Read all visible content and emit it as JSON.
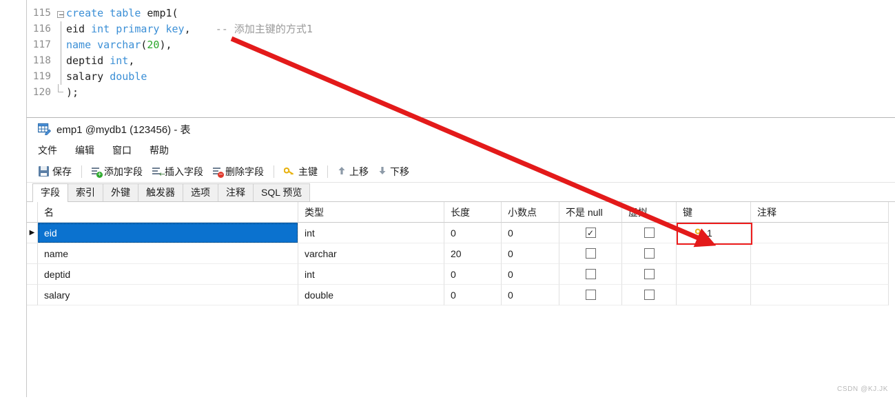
{
  "editor": {
    "lines": [
      {
        "num": "115",
        "tokens": [
          {
            "t": "create",
            "c": "kw"
          },
          {
            "t": " ",
            "c": "plain"
          },
          {
            "t": "table",
            "c": "kw"
          },
          {
            "t": " emp1(",
            "c": "plain"
          }
        ]
      },
      {
        "num": "116",
        "tokens": [
          {
            "t": "eid ",
            "c": "plain"
          },
          {
            "t": "int",
            "c": "kw"
          },
          {
            "t": " ",
            "c": "plain"
          },
          {
            "t": "primary",
            "c": "kw"
          },
          {
            "t": " ",
            "c": "plain"
          },
          {
            "t": "key",
            "c": "kw"
          },
          {
            "t": ",",
            "c": "plain"
          },
          {
            "t": "    -- 添加主键的方式1",
            "c": "cmt"
          }
        ]
      },
      {
        "num": "117",
        "tokens": [
          {
            "t": "name",
            "c": "kw"
          },
          {
            "t": " ",
            "c": "plain"
          },
          {
            "t": "varchar",
            "c": "kw"
          },
          {
            "t": "(",
            "c": "plain"
          },
          {
            "t": "20",
            "c": "num"
          },
          {
            "t": "),",
            "c": "plain"
          }
        ]
      },
      {
        "num": "118",
        "tokens": [
          {
            "t": "deptid ",
            "c": "plain"
          },
          {
            "t": "int",
            "c": "kw"
          },
          {
            "t": ",",
            "c": "plain"
          }
        ]
      },
      {
        "num": "119",
        "tokens": [
          {
            "t": "salary ",
            "c": "plain"
          },
          {
            "t": "double",
            "c": "kw"
          }
        ]
      },
      {
        "num": "120",
        "tokens": [
          {
            "t": ");",
            "c": "plain"
          }
        ]
      }
    ]
  },
  "window": {
    "title": "emp1 @mydb1 (123456) - 表",
    "title_icon": "table-design-icon",
    "menu": [
      {
        "label": "文件",
        "name": "menu-file"
      },
      {
        "label": "编辑",
        "name": "menu-edit"
      },
      {
        "label": "窗口",
        "name": "menu-window"
      },
      {
        "label": "帮助",
        "name": "menu-help"
      }
    ],
    "toolbar": [
      {
        "label": "保存",
        "icon": "save-icon",
        "name": "toolbar-save"
      },
      {
        "label": "添加字段",
        "icon": "add-field-icon",
        "name": "toolbar-add-field"
      },
      {
        "label": "插入字段",
        "icon": "insert-field-icon",
        "name": "toolbar-insert-field"
      },
      {
        "label": "删除字段",
        "icon": "delete-field-icon",
        "name": "toolbar-delete-field"
      },
      {
        "label": "主键",
        "icon": "key-icon",
        "name": "toolbar-primary-key"
      },
      {
        "label": "上移",
        "icon": "arrow-up-icon",
        "name": "toolbar-move-up"
      },
      {
        "label": "下移",
        "icon": "arrow-down-icon",
        "name": "toolbar-move-down"
      }
    ],
    "tabs": [
      {
        "label": "字段",
        "active": true
      },
      {
        "label": "索引",
        "active": false
      },
      {
        "label": "外键",
        "active": false
      },
      {
        "label": "触发器",
        "active": false
      },
      {
        "label": "选项",
        "active": false
      },
      {
        "label": "注释",
        "active": false
      },
      {
        "label": "SQL 预览",
        "active": false
      }
    ]
  },
  "grid": {
    "columns": [
      "名",
      "类型",
      "长度",
      "小数点",
      "不是 null",
      "虚拟",
      "键",
      "注释"
    ],
    "rows": [
      {
        "selected": true,
        "marker": "▶",
        "name": "eid",
        "type": "int",
        "length": "0",
        "decimals": "0",
        "not_null": true,
        "virtual": false,
        "key": "1",
        "key_icon": "key-icon",
        "comment": ""
      },
      {
        "selected": false,
        "marker": "",
        "name": "name",
        "type": "varchar",
        "length": "20",
        "decimals": "0",
        "not_null": false,
        "virtual": false,
        "key": "",
        "key_icon": "",
        "comment": ""
      },
      {
        "selected": false,
        "marker": "",
        "name": "deptid",
        "type": "int",
        "length": "0",
        "decimals": "0",
        "not_null": false,
        "virtual": false,
        "key": "",
        "key_icon": "",
        "comment": ""
      },
      {
        "selected": false,
        "marker": "",
        "name": "salary",
        "type": "double",
        "length": "0",
        "decimals": "0",
        "not_null": false,
        "virtual": false,
        "key": "",
        "key_icon": "",
        "comment": ""
      }
    ],
    "checked_glyph": "✓"
  },
  "annotations": {
    "arrow_color": "#e31a1a",
    "highlight_color": "#ee1c1c"
  },
  "watermark": {
    "diagonal": "CSDN@KJ.JK",
    "corner": "CSDN @KJ.JK"
  },
  "colors": {
    "selection_blue": "#0b72cf",
    "keyword_blue": "#3b8fd6",
    "number_green": "#2ba62b",
    "comment_gray": "#9a9a9a",
    "key_gold": "#e8b210"
  }
}
